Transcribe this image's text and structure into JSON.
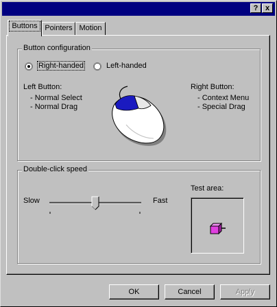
{
  "titlebar": {
    "help": "?",
    "close": "x"
  },
  "tabs": [
    {
      "label": "Buttons"
    },
    {
      "label": "Pointers"
    },
    {
      "label": "Motion"
    }
  ],
  "button_config": {
    "title": "Button configuration",
    "right_handed": "Right-handed",
    "left_handed": "Left-handed",
    "selected": "right-handed",
    "left_button_title": "Left Button:",
    "left_items": [
      "-  Normal Select",
      "-  Normal Drag"
    ],
    "right_button_title": "Right Button:",
    "right_items": [
      "-  Context Menu",
      "-  Special Drag"
    ]
  },
  "double_click": {
    "title": "Double-click speed",
    "slow": "Slow",
    "fast": "Fast",
    "slider_value": 0.5,
    "test_area": "Test area:"
  },
  "footer": {
    "ok": "OK",
    "cancel": "Cancel",
    "apply": "Apply"
  },
  "colors": {
    "title_bar": "#000080",
    "mouse_button_accent": "#1a1ac0",
    "test_box": "#e040e0"
  }
}
